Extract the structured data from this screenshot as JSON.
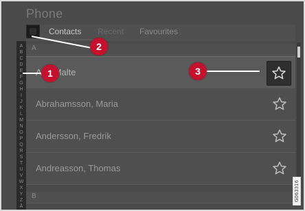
{
  "app": {
    "title": "Phone"
  },
  "tabs": [
    {
      "label": "Contacts",
      "active": true
    },
    {
      "label": "Recent",
      "active": false
    },
    {
      "label": "Favourites",
      "active": false
    }
  ],
  "alphabet": [
    "A",
    "B",
    "C",
    "D",
    "E",
    "F",
    "G",
    "H",
    "I",
    "J",
    "K",
    "L",
    "M",
    "N",
    "O",
    "P",
    "Q",
    "R",
    "S",
    "T",
    "U",
    "V",
    "W",
    "X",
    "Y",
    "Z",
    "Å"
  ],
  "sections": {
    "top": "A",
    "bottom": "B"
  },
  "contacts": [
    {
      "name": "A..., Malte"
    },
    {
      "name": "Abrahamsson, Maria"
    },
    {
      "name": "Andersson, Fredrik"
    },
    {
      "name": "Andreasson, Thomas"
    }
  ],
  "callouts": [
    "1",
    "2",
    "3"
  ],
  "figure_code": "G063316",
  "colors": {
    "callout": "#c3112e",
    "scroll_thumb": "#cfcfcf"
  },
  "icons": {
    "favorite": "star-outline-icon"
  }
}
